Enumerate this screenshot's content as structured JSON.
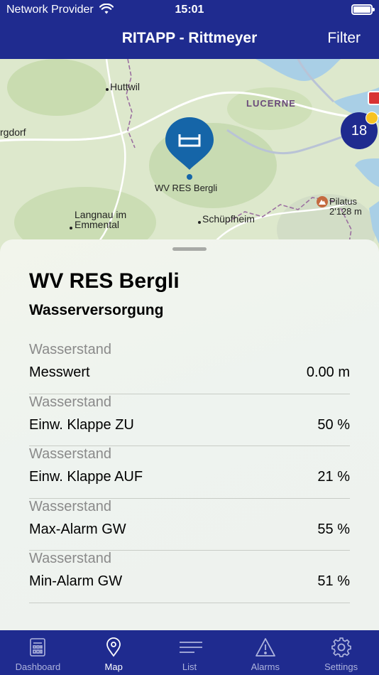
{
  "status_bar": {
    "carrier": "Network Provider",
    "time": "15:01"
  },
  "nav": {
    "title": "RITAPP - Rittmeyer",
    "filter_label": "Filter"
  },
  "map": {
    "places": {
      "huttwil": "Huttwil",
      "lucerne": "LUCERNE",
      "burgdorf": "rgdorf",
      "langnau_line1": "Langnau im",
      "langnau_line2": "Emmental",
      "schuepfheim": "Schüpfheim",
      "pilatus_name": "Pilatus",
      "pilatus_height": "2'128 m",
      "pin_label": "WV RES Bergli"
    },
    "cluster_count": "18",
    "pin_color": "#1565a8",
    "water_color": "#a9cfe6"
  },
  "sheet": {
    "name": "WV RES Bergli",
    "subtitle": "Wasserversorgung",
    "rows": [
      {
        "category": "Wasserstand",
        "label": "Messwert",
        "value": "0.00 m"
      },
      {
        "category": "Wasserstand",
        "label": "Einw. Klappe ZU",
        "value": "50 %"
      },
      {
        "category": "Wasserstand",
        "label": "Einw. Klappe AUF",
        "value": "21 %"
      },
      {
        "category": "Wasserstand",
        "label": "Max-Alarm GW",
        "value": "55 %"
      },
      {
        "category": "Wasserstand",
        "label": "Min-Alarm GW",
        "value": "51 %"
      }
    ]
  },
  "tabs": [
    {
      "label": "Dashboard",
      "icon": "dashboard-icon"
    },
    {
      "label": "Map",
      "icon": "map-pin-icon",
      "active": true
    },
    {
      "label": "List",
      "icon": "list-icon"
    },
    {
      "label": "Alarms",
      "icon": "alarm-triangle-icon"
    },
    {
      "label": "Settings",
      "icon": "gear-icon"
    }
  ],
  "colors": {
    "brand": "#1f2b8f",
    "tab_inactive": "#aeb4dd"
  }
}
